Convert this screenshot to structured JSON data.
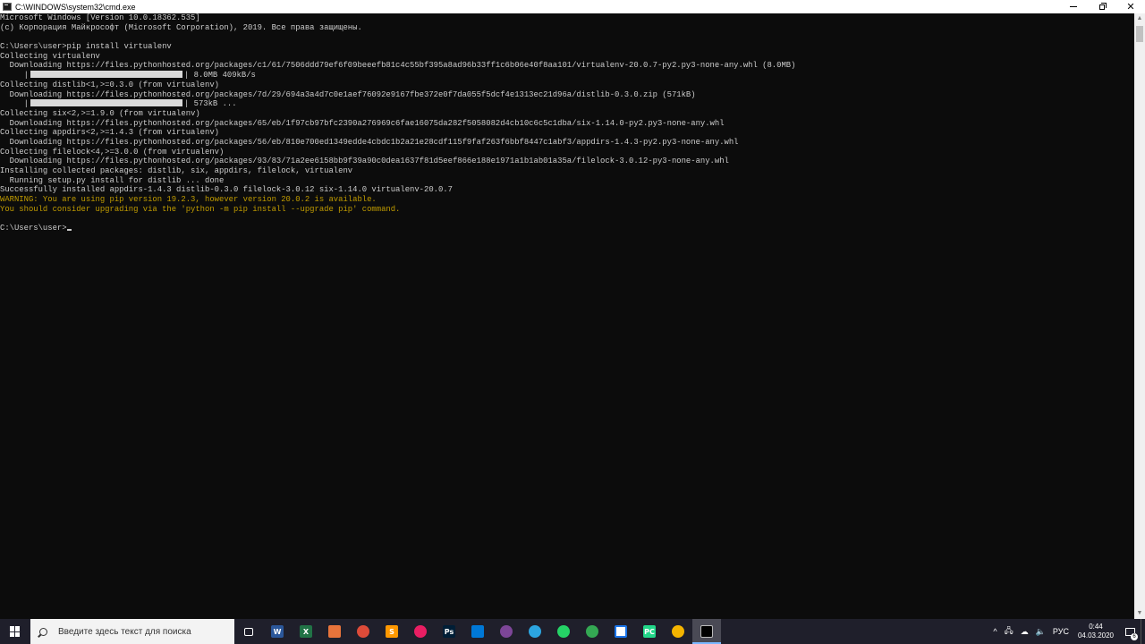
{
  "window": {
    "title": "C:\\WINDOWS\\system32\\cmd.exe",
    "minimize_label": "",
    "close_label": "✕"
  },
  "console": {
    "lines": [
      {
        "text": "Microsoft Windows [Version 10.0.18362.535]"
      },
      {
        "text": "(c) Корпорация Майкрософт (Microsoft Corporation), 2019. Все права защищены."
      },
      {
        "text": ""
      },
      {
        "text": "C:\\Users\\user>pip install virtualenv"
      },
      {
        "text": "Collecting virtualenv"
      },
      {
        "text": "  Downloading https://files.pythonhosted.org/packages/c1/61/7506ddd79ef6f09beeefb81c4c55bf395a8ad96b33ff1c6b06e40f8aa101/virtualenv-20.0.7-py2.py3-none-any.whl (8.0MB)"
      },
      {
        "progress": true,
        "prefix": "     |",
        "suffix": "| 8.0MB 409kB/s"
      },
      {
        "text": "Collecting distlib<1,>=0.3.0 (from virtualenv)"
      },
      {
        "text": "  Downloading https://files.pythonhosted.org/packages/7d/29/694a3a4d7c0e1aef76092e9167fbe372e0f7da055f5dcf4e1313ec21d96a/distlib-0.3.0.zip (571kB)"
      },
      {
        "progress": true,
        "prefix": "     |",
        "suffix": "| 573kB ..."
      },
      {
        "text": "Collecting six<2,>=1.9.0 (from virtualenv)"
      },
      {
        "text": "  Downloading https://files.pythonhosted.org/packages/65/eb/1f97cb97bfc2390a276969c6fae16075da282f5058082d4cb10c6c5c1dba/six-1.14.0-py2.py3-none-any.whl"
      },
      {
        "text": "Collecting appdirs<2,>=1.4.3 (from virtualenv)"
      },
      {
        "text": "  Downloading https://files.pythonhosted.org/packages/56/eb/810e700ed1349edde4cbdc1b2a21e28cdf115f9faf263f6bbf8447c1abf3/appdirs-1.4.3-py2.py3-none-any.whl"
      },
      {
        "text": "Collecting filelock<4,>=3.0.0 (from virtualenv)"
      },
      {
        "text": "  Downloading https://files.pythonhosted.org/packages/93/83/71a2ee6158bb9f39a90c0dea1637f81d5eef866e188e1971a1b1ab01a35a/filelock-3.0.12-py3-none-any.whl"
      },
      {
        "text": "Installing collected packages: distlib, six, appdirs, filelock, virtualenv"
      },
      {
        "text": "  Running setup.py install for distlib ... done"
      },
      {
        "text": "Successfully installed appdirs-1.4.3 distlib-0.3.0 filelock-3.0.12 six-1.14.0 virtualenv-20.0.7"
      },
      {
        "text": "WARNING: You are using pip version 19.2.3, however version 20.0.2 is available.",
        "warn": true
      },
      {
        "text": "You should consider upgrading via the 'python -m pip install --upgrade pip' command.",
        "warn": true
      },
      {
        "text": ""
      },
      {
        "text": "C:\\Users\\user>",
        "cursor": true
      }
    ],
    "text_color": "#cccccc",
    "warning_color": "#c19c00",
    "background": "#0c0c0c"
  },
  "taskbar": {
    "search_placeholder": "Введите здесь текст для поиска",
    "apps": [
      {
        "name": "task-view-icon",
        "label": "",
        "color": "transparent",
        "glyph": "⧉"
      },
      {
        "name": "word-icon",
        "label": "W",
        "color": "#2b579a"
      },
      {
        "name": "excel-icon",
        "label": "X",
        "color": "#217346"
      },
      {
        "name": "files-icon",
        "label": "",
        "color": "#e8743b"
      },
      {
        "name": "chrome-icon",
        "label": "",
        "color": "#dd4b39"
      },
      {
        "name": "sublime-icon",
        "label": "S",
        "color": "#ff9800"
      },
      {
        "name": "colorful-app-icon",
        "label": "",
        "color": "#e91e63"
      },
      {
        "name": "photoshop-icon",
        "label": "Ps",
        "color": "#001e36"
      },
      {
        "name": "vscode-icon",
        "label": "",
        "color": "#0078d7"
      },
      {
        "name": "tor-icon",
        "label": "",
        "color": "#7d4698"
      },
      {
        "name": "telegram-icon",
        "label": "",
        "color": "#2ca5e0"
      },
      {
        "name": "whatsapp-icon",
        "label": "",
        "color": "#25d366"
      },
      {
        "name": "vpn-icon",
        "label": "",
        "color": "#34a853"
      },
      {
        "name": "notepad-icon",
        "label": "",
        "color": "#ffffff"
      },
      {
        "name": "pycharm-icon",
        "label": "PC",
        "color": "#21d789"
      },
      {
        "name": "chrome-canary-icon",
        "label": "",
        "color": "#f4b400"
      },
      {
        "name": "cmd-icon",
        "label": "",
        "color": "#000000"
      }
    ],
    "tray": {
      "chevron": "^",
      "language": "РУС",
      "time": "0:44",
      "date": "04.03.2020",
      "notifications": "6"
    }
  }
}
